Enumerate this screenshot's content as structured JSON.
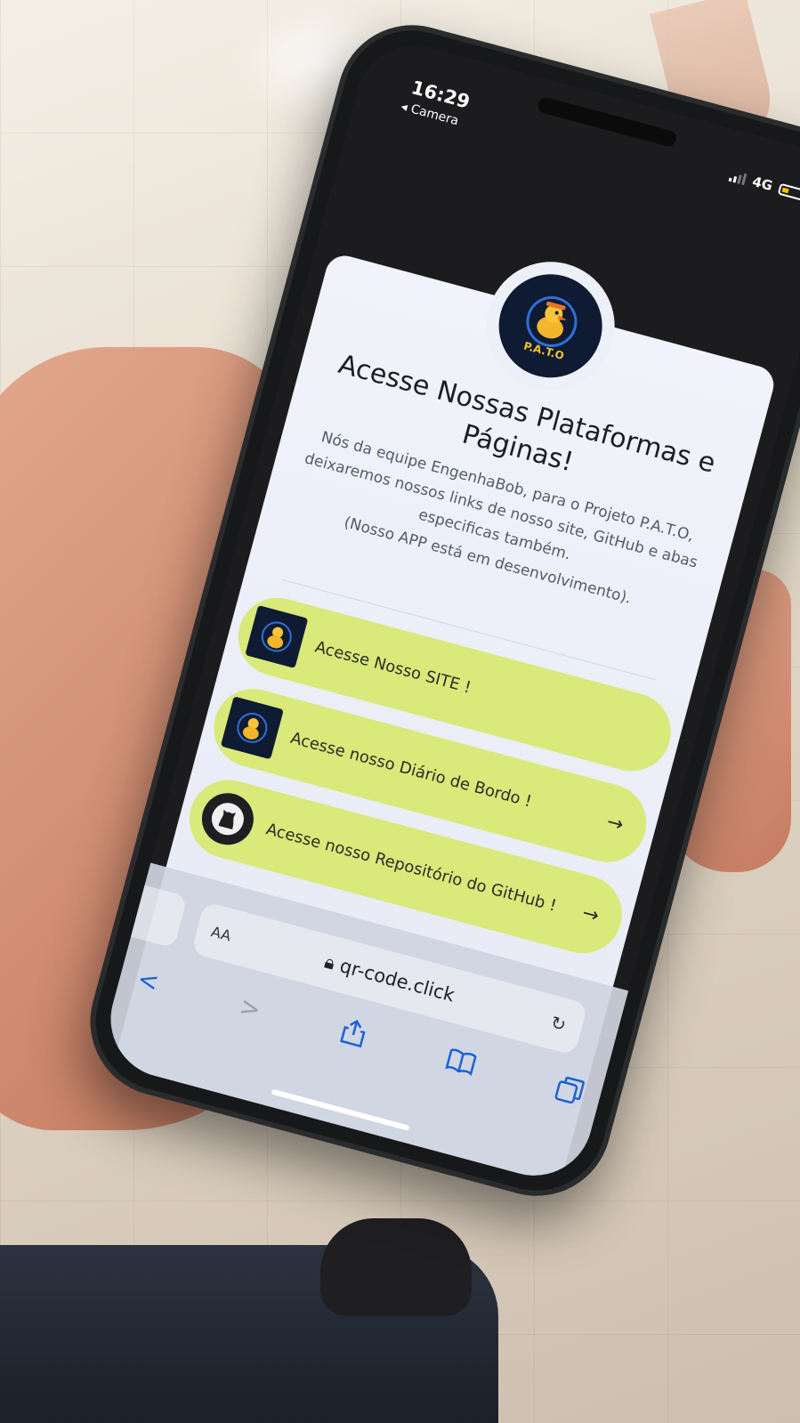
{
  "status_bar": {
    "time": "16:29",
    "back_label": "◂ Camera",
    "network": "4G"
  },
  "logo": {
    "text": "P.A.T.O",
    "icon": "duck-icon"
  },
  "page": {
    "title": "Acesse Nossas Plataformas e Páginas!",
    "description": "Nós da equipe EngenhaBob, para o Projeto P.A.T.O, deixaremos nossos links de nosso site, GitHub e abas especificas também.",
    "note": "(Nosso APP está em desenvolvimento)."
  },
  "links": [
    {
      "label": "Acesse Nosso SITE !",
      "icon": "pato-logo-icon"
    },
    {
      "label": "Acesse nosso Diário de Bordo !",
      "icon": "pato-logo-icon"
    },
    {
      "label": "Acesse nosso Repositório do GitHub !",
      "icon": "github-icon"
    }
  ],
  "link_arrow": "→",
  "browser": {
    "text_size": "AA",
    "url": "qr-code.click",
    "back": "<",
    "forward": ">"
  },
  "colors": {
    "link_background": "#d9e97a",
    "accent": "#1a62d6"
  }
}
